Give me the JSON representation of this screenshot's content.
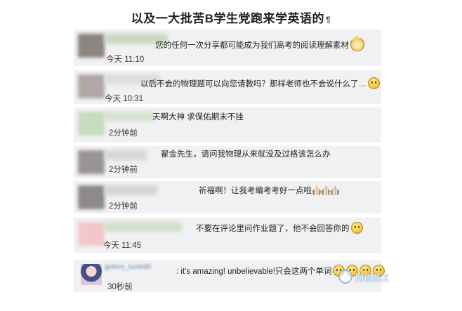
{
  "title": "以及一大批苦B学生党跑来学英语的",
  "title_mark": "¶",
  "comments": [
    {
      "text": "您的任何一次分享都可能成为我们高考的阅读理解素材",
      "time": "今天 11:10",
      "emoji": "cat-face-icon"
    },
    {
      "text": "以后不会的物理题可以向您请教吗？那样老师也不会说什么了…",
      "time": "今天 10:31",
      "emoji": "face-icon"
    },
    {
      "text": "天啊大神 求保佑期末不挂",
      "time": "2分钟前"
    },
    {
      "text": "翟金先生，请问我物理从来就没及过格该怎么办",
      "time": "2分钟前"
    },
    {
      "text": "祈福啊！让我考编考考好一点啦",
      "time": "2分钟前",
      "emoji": "praying-hands-icon"
    },
    {
      "text": "不要在评论里问作业题了，他不会回答你的",
      "time": "今天 11:45",
      "emoji": "smile-face-icon"
    },
    {
      "nickname": "gotoro_lusted0",
      "text": ": it's amazing!  unbelievable!只会这两个单词",
      "time": "30秒前",
      "emoji": "laughing-face-icon"
    }
  ],
  "watermark": "网信浙江"
}
